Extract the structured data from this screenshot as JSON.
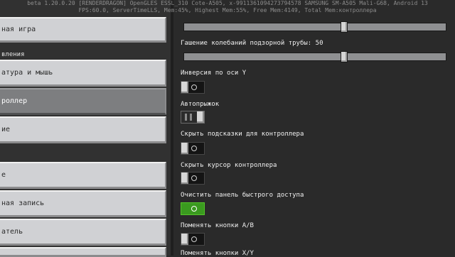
{
  "debug": {
    "line1": "beta 1.20.0.20 [RENDERDRAGON] OpenGLES ESSL_310 Cote-A505, x-9911361094273794578 SAMSUNG SM-A505 Mali-G68, Android 13",
    "line2": "FPS:60.0, ServerTimeLLS, Mem:45%, Highest Mem:55%, Free Mem:4149, Total Mem:контроллера"
  },
  "left_panel": {
    "items": [
      {
        "label": "ная игра",
        "selected": false
      },
      {
        "label": "атура и мышь",
        "selected": false
      },
      {
        "label": "роллер",
        "selected": true
      },
      {
        "label": "ие",
        "selected": false
      },
      {
        "label": "е",
        "selected": false
      },
      {
        "label": "ная запись",
        "selected": false
      },
      {
        "label": "атель",
        "selected": false
      }
    ],
    "section_label": "вления"
  },
  "right_panel": {
    "slider1": {
      "value_fraction": 0.6
    },
    "slider2": {
      "label": "Гашение колебаний подзорной трубы: 50",
      "value": 50,
      "value_fraction": 0.6
    },
    "options": [
      {
        "label": "Инверсия по оси Y",
        "state": "off"
      },
      {
        "label": "Автопрыжок",
        "state": "disabled"
      },
      {
        "label": "Скрыть подсказки для контроллера",
        "state": "off"
      },
      {
        "label": "Скрыть курсор контроллера",
        "state": "off"
      },
      {
        "label": "Очистить панель быстрого доступа",
        "state": "on"
      },
      {
        "label": "Поменять кнопки A/B",
        "state": "off"
      },
      {
        "label": "Поменять кнопки X/Y",
        "state": "off"
      }
    ]
  }
}
